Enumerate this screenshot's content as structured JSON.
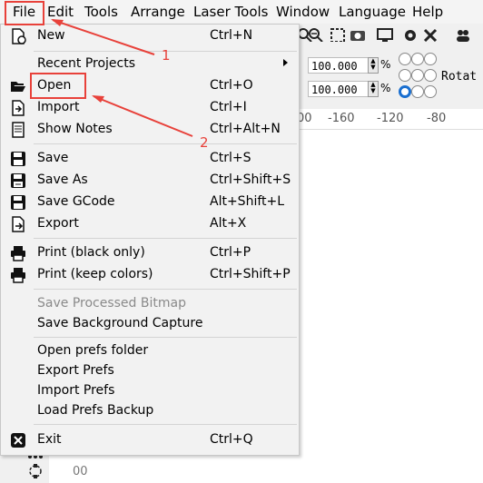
{
  "menubar": [
    "File",
    "Edit",
    "Tools",
    "Arrange",
    "Laser Tools",
    "Window",
    "Language",
    "Help"
  ],
  "menu": {
    "new": {
      "label": "New",
      "shortcut": "Ctrl+N"
    },
    "recent": {
      "label": "Recent Projects"
    },
    "open": {
      "label": "Open",
      "shortcut": "Ctrl+O"
    },
    "import": {
      "label": "Import",
      "shortcut": "Ctrl+I"
    },
    "show_notes": {
      "label": "Show Notes",
      "shortcut": "Ctrl+Alt+N"
    },
    "save": {
      "label": "Save",
      "shortcut": "Ctrl+S"
    },
    "save_as": {
      "label": "Save As",
      "shortcut": "Ctrl+Shift+S"
    },
    "save_gcode": {
      "label": "Save GCode",
      "shortcut": "Alt+Shift+L"
    },
    "export": {
      "label": "Export",
      "shortcut": "Alt+X"
    },
    "print_black": {
      "label": "Print (black only)",
      "shortcut": "Ctrl+P"
    },
    "print_colors": {
      "label": "Print (keep colors)",
      "shortcut": "Ctrl+Shift+P"
    },
    "save_bitmap": {
      "label": "Save Processed Bitmap"
    },
    "save_bg": {
      "label": "Save Background Capture"
    },
    "open_prefs": {
      "label": "Open prefs folder"
    },
    "export_prefs": {
      "label": "Export Prefs"
    },
    "import_prefs": {
      "label": "Import Prefs"
    },
    "load_backup": {
      "label": "Load Prefs Backup"
    },
    "exit": {
      "label": "Exit",
      "shortcut": "Ctrl+Q"
    }
  },
  "panel": {
    "width_value": "100.000",
    "height_value": "100.000",
    "percent": "%",
    "rotate_label": "Rotat"
  },
  "ruler": [
    "00",
    "-160",
    "-120",
    "-80"
  ],
  "canvas_tick": "00",
  "annotations": {
    "one": "1",
    "two": "2"
  },
  "colors": {
    "annotation": "#e8413a",
    "menu_bg": "#f2f2f2",
    "radio_selected": "#1a6fd0"
  }
}
